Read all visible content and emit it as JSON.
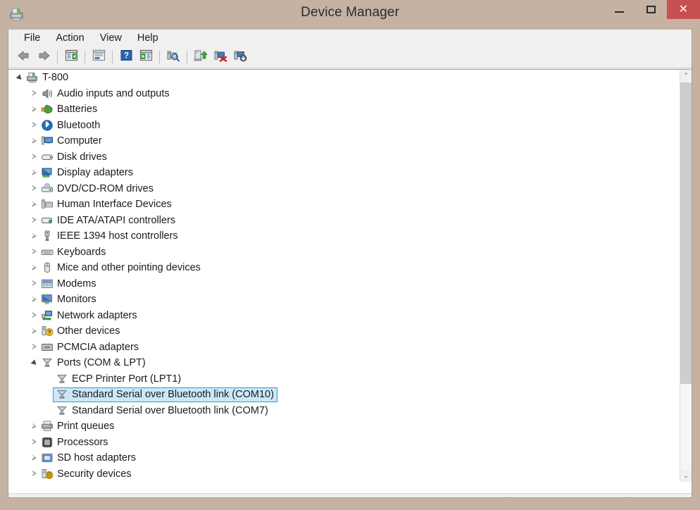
{
  "window": {
    "title": "Device Manager",
    "icon": "device-manager-icon",
    "controls": {
      "minimize": "—",
      "maximize": "☐",
      "close": "✕"
    },
    "frame_color": "#c6b2a2",
    "close_color": "#c75050"
  },
  "menu": {
    "items": [
      {
        "label": "File"
      },
      {
        "label": "Action"
      },
      {
        "label": "View"
      },
      {
        "label": "Help"
      }
    ]
  },
  "toolbar": {
    "buttons": [
      {
        "name": "back-arrow-icon",
        "tip": "Back"
      },
      {
        "name": "forward-arrow-icon",
        "tip": "Forward"
      },
      {
        "name": "separator-1",
        "tip": ""
      },
      {
        "name": "show-hide-console-tree-icon",
        "tip": "Show/Hide Console Tree"
      },
      {
        "name": "separator-2",
        "tip": ""
      },
      {
        "name": "properties-icon",
        "tip": "Properties"
      },
      {
        "name": "separator-3",
        "tip": ""
      },
      {
        "name": "help-icon",
        "tip": "Help"
      },
      {
        "name": "show-hide-action-pane-icon",
        "tip": "Show/Hide Action Pane"
      },
      {
        "name": "separator-4",
        "tip": ""
      },
      {
        "name": "scan-for-hardware-changes-icon",
        "tip": "Scan for hardware changes"
      },
      {
        "name": "separator-5",
        "tip": ""
      },
      {
        "name": "update-driver-icon",
        "tip": "Update Driver Software"
      },
      {
        "name": "uninstall-device-icon",
        "tip": "Uninstall"
      },
      {
        "name": "disable-device-icon",
        "tip": "Disable"
      }
    ]
  },
  "tree": {
    "selected_colors": {
      "fill": "#cce8f7",
      "border": "#26a0da"
    },
    "rows": [
      {
        "label": "T-800",
        "depth": 0,
        "state": "expanded",
        "icon": "computer-icon",
        "selected": false
      },
      {
        "label": "Audio inputs and outputs",
        "depth": 1,
        "state": "collapsed",
        "icon": "speaker-icon",
        "selected": false
      },
      {
        "label": "Batteries",
        "depth": 1,
        "state": "collapsed",
        "icon": "battery-icon",
        "selected": false
      },
      {
        "label": "Bluetooth",
        "depth": 1,
        "state": "collapsed",
        "icon": "bluetooth-icon",
        "selected": false
      },
      {
        "label": "Computer",
        "depth": 1,
        "state": "collapsed",
        "icon": "computer-device-icon",
        "selected": false
      },
      {
        "label": "Disk drives",
        "depth": 1,
        "state": "collapsed",
        "icon": "disk-drive-icon",
        "selected": false
      },
      {
        "label": "Display adapters",
        "depth": 1,
        "state": "collapsed",
        "icon": "display-adapter-icon",
        "selected": false
      },
      {
        "label": "DVD/CD-ROM drives",
        "depth": 1,
        "state": "collapsed",
        "icon": "dvd-drive-icon",
        "selected": false
      },
      {
        "label": "Human Interface Devices",
        "depth": 1,
        "state": "collapsed",
        "icon": "hid-icon",
        "selected": false
      },
      {
        "label": "IDE ATA/ATAPI controllers",
        "depth": 1,
        "state": "collapsed",
        "icon": "ide-controller-icon",
        "selected": false
      },
      {
        "label": "IEEE 1394 host controllers",
        "depth": 1,
        "state": "collapsed",
        "icon": "ieee1394-icon",
        "selected": false
      },
      {
        "label": "Keyboards",
        "depth": 1,
        "state": "collapsed",
        "icon": "keyboard-icon",
        "selected": false
      },
      {
        "label": "Mice and other pointing devices",
        "depth": 1,
        "state": "collapsed",
        "icon": "mouse-icon",
        "selected": false
      },
      {
        "label": "Modems",
        "depth": 1,
        "state": "collapsed",
        "icon": "modem-icon",
        "selected": false
      },
      {
        "label": "Monitors",
        "depth": 1,
        "state": "collapsed",
        "icon": "monitor-icon",
        "selected": false
      },
      {
        "label": "Network adapters",
        "depth": 1,
        "state": "collapsed",
        "icon": "network-adapter-icon",
        "selected": false
      },
      {
        "label": "Other devices",
        "depth": 1,
        "state": "collapsed",
        "icon": "other-device-icon",
        "selected": false
      },
      {
        "label": "PCMCIA adapters",
        "depth": 1,
        "state": "collapsed",
        "icon": "pcmcia-icon",
        "selected": false
      },
      {
        "label": "Ports (COM & LPT)",
        "depth": 1,
        "state": "expanded",
        "icon": "port-icon",
        "selected": false
      },
      {
        "label": "ECP Printer Port (LPT1)",
        "depth": 2,
        "state": "leaf",
        "icon": "port-icon",
        "selected": false
      },
      {
        "label": "Standard Serial over Bluetooth link (COM10)",
        "depth": 2,
        "state": "leaf",
        "icon": "port-icon",
        "selected": true
      },
      {
        "label": "Standard Serial over Bluetooth link (COM7)",
        "depth": 2,
        "state": "leaf",
        "icon": "port-icon",
        "selected": false
      },
      {
        "label": "Print queues",
        "depth": 1,
        "state": "collapsed",
        "icon": "printer-icon",
        "selected": false
      },
      {
        "label": "Processors",
        "depth": 1,
        "state": "collapsed",
        "icon": "processor-icon",
        "selected": false
      },
      {
        "label": "SD host adapters",
        "depth": 1,
        "state": "collapsed",
        "icon": "sd-host-icon",
        "selected": false
      },
      {
        "label": "Security devices",
        "depth": 1,
        "state": "collapsed",
        "icon": "security-device-icon",
        "selected": false
      }
    ]
  },
  "scrollbar": {
    "up_glyph": "⌃",
    "down_glyph": "⌄"
  },
  "statusbar": {
    "panes": [
      {
        "text": ""
      },
      {
        "text": ""
      },
      {
        "text": ""
      }
    ]
  }
}
